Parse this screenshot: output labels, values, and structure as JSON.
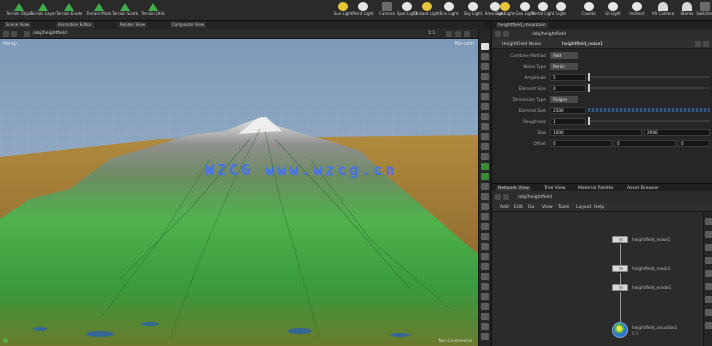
{
  "shelf": {
    "tools": [
      {
        "icon": "terrain-icon",
        "label": "Terrain Object"
      },
      {
        "icon": "terrain-icon",
        "label": "Terrain Layer"
      },
      {
        "icon": "terrain-icon",
        "label": "Terrain Erode"
      },
      {
        "icon": "terrain-icon",
        "label": "Terrain Mask"
      },
      {
        "icon": "terrain-icon",
        "label": "Terrain Scatter"
      },
      {
        "icon": "terrain-icon",
        "label": "Terrain Utils"
      },
      {
        "icon": "sun-icon",
        "label": "Sun Light"
      },
      {
        "icon": "light-icon",
        "label": "Point Light"
      },
      {
        "icon": "camera-icon",
        "label": "Camera"
      },
      {
        "icon": "light-icon",
        "label": "Spot Light"
      },
      {
        "icon": "sun-icon",
        "label": "Distant Light"
      },
      {
        "icon": "light-icon",
        "label": "Env Light"
      },
      {
        "icon": "light-icon",
        "label": "Sky Light"
      },
      {
        "icon": "light-icon",
        "label": "Area Light"
      },
      {
        "icon": "sun-icon",
        "label": "Sun Light"
      },
      {
        "icon": "light-icon",
        "label": "Geo Light"
      },
      {
        "icon": "light-icon",
        "label": "Portal Light"
      },
      {
        "icon": "light-icon",
        "label": "Light"
      },
      {
        "icon": "light-icon",
        "label": "Caustic"
      },
      {
        "icon": "light-icon",
        "label": "GI Light"
      },
      {
        "icon": "light-icon",
        "label": "Indirect"
      },
      {
        "icon": "dome-icon",
        "label": "VR Camera"
      },
      {
        "icon": "dome-icon",
        "label": "Stereo"
      },
      {
        "icon": "camera-icon",
        "label": "Switcher"
      }
    ]
  },
  "left_tabs": [
    "Scene View",
    "Animation Editor",
    "Render View",
    "Composite View"
  ],
  "viewport_bar": {
    "path": "/obj/heightfield",
    "zoom": "1:1"
  },
  "viewport": {
    "mode": "Persp",
    "camera": "No cam",
    "status": "Non-Commercial",
    "watermark": "WZCG www.wzcg.cn"
  },
  "right_tabs": [
    "heightfield_mountain"
  ],
  "params": {
    "node_type": "HeightField Noise",
    "node_name": "heightfield_noise1",
    "rows": [
      {
        "label": "Combine Method",
        "value": "Add",
        "kind": "dd"
      },
      {
        "label": "Noise Type",
        "value": "Perlin",
        "kind": "dd"
      },
      {
        "label": "Amplitude",
        "value": "5",
        "kind": "slider"
      },
      {
        "label": "Element Size",
        "value": "0",
        "kind": "slider"
      },
      {
        "label": "Dimension Type",
        "value": "Ridges",
        "kind": "dd"
      },
      {
        "label": "Element Size",
        "value": "2500",
        "kind": "stripe"
      },
      {
        "label": "Roughness",
        "value": "1",
        "kind": "slider"
      },
      {
        "label": "Size",
        "value": "1000",
        "value2": "2000",
        "kind": "pair"
      },
      {
        "label": "Offset",
        "value": "0",
        "value2": "0",
        "value3": "0",
        "kind": "triple"
      }
    ]
  },
  "network": {
    "tabs": [
      "Network View",
      "Tree View",
      "Material Palette",
      "Asset Browser"
    ],
    "path": "/obj/heightfield",
    "menu": [
      "Add",
      "Edit",
      "Go",
      "View",
      "Tools",
      "Layout",
      "Help"
    ],
    "nodes": [
      {
        "label": "heightfield_noise1",
        "sub": ""
      },
      {
        "label": "heightfield_mask1",
        "sub": ""
      },
      {
        "label": "heightfield_erode1",
        "sub": ""
      },
      {
        "label": "heightfield_visualize1",
        "sub": "0 5"
      }
    ]
  }
}
